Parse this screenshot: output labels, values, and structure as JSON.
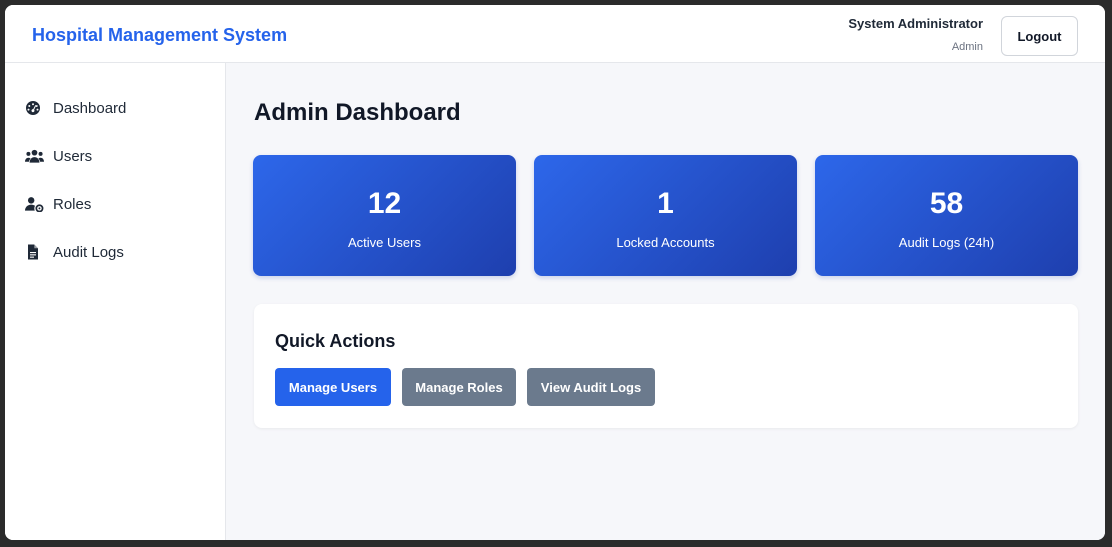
{
  "header": {
    "brand": "Hospital Management System",
    "user_name": "System Administrator",
    "user_role": "Admin",
    "logout_label": "Logout"
  },
  "sidebar": {
    "items": [
      {
        "label": "Dashboard",
        "icon": "dashboard-icon"
      },
      {
        "label": "Users",
        "icon": "users-icon"
      },
      {
        "label": "Roles",
        "icon": "user-cog-icon"
      },
      {
        "label": "Audit Logs",
        "icon": "file-icon"
      }
    ]
  },
  "main": {
    "title": "Admin Dashboard",
    "stats": [
      {
        "value": "12",
        "label": "Active Users"
      },
      {
        "value": "1",
        "label": "Locked Accounts"
      },
      {
        "value": "58",
        "label": "Audit Logs (24h)"
      }
    ],
    "quick_actions": {
      "title": "Quick Actions",
      "buttons": [
        {
          "label": "Manage Users"
        },
        {
          "label": "Manage Roles"
        },
        {
          "label": "View Audit Logs"
        }
      ]
    }
  },
  "colors": {
    "accent": "#2563eb",
    "card_gradient_start": "#2d67ea",
    "card_gradient_end": "#1e3fae",
    "secondary_button": "#6b7a8d"
  }
}
